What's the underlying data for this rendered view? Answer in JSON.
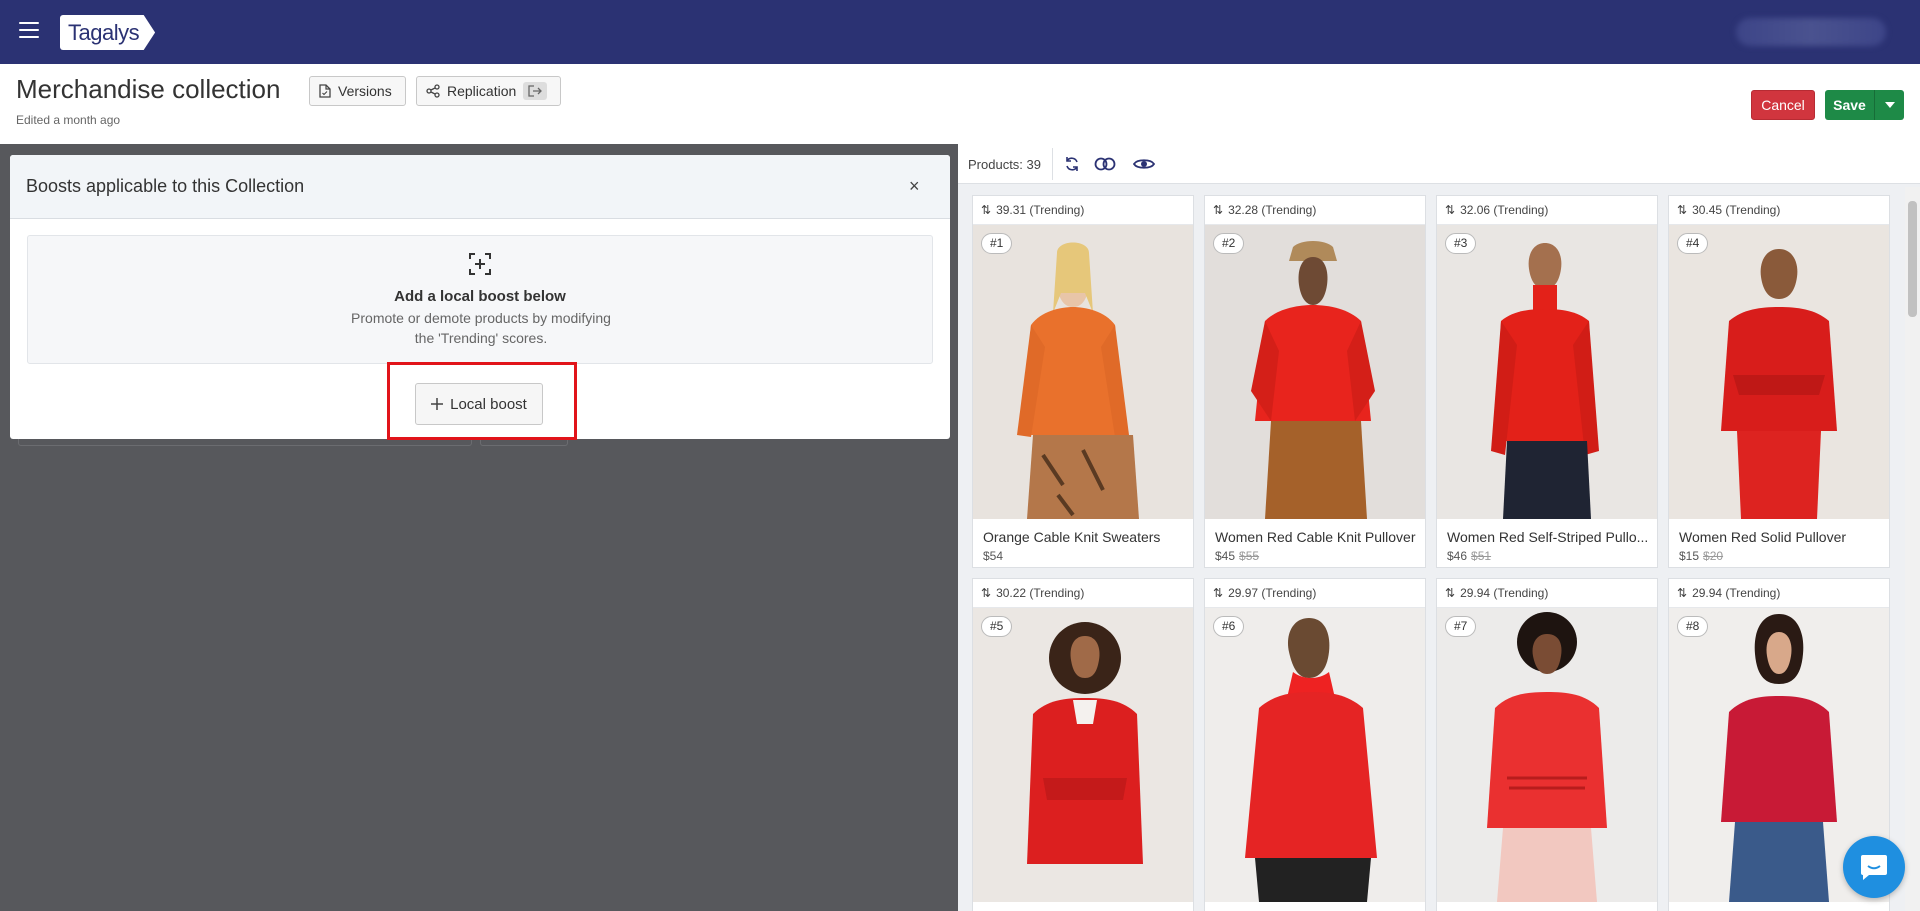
{
  "app": {
    "logo": "Tagalys"
  },
  "header": {
    "title": "Merchandise collection",
    "edited": "Edited a month ago",
    "versions_label": "Versions",
    "replication_label": "Replication",
    "cancel_label": "Cancel",
    "save_label": "Save"
  },
  "modal": {
    "title": "Boosts applicable to this Collection",
    "close": "×",
    "empty_title": "Add a local boost below",
    "empty_desc": "Promote or demote products by modifying the 'Trending' scores.",
    "local_boost_label": "Local boost"
  },
  "products": {
    "count_label": "Products: 39",
    "cards": [
      {
        "score": "39.31 (Trending)",
        "rank": "#1",
        "name": "Orange Cable Knit Sweaters",
        "price": "$54",
        "old_price": ""
      },
      {
        "score": "32.28 (Trending)",
        "rank": "#2",
        "name": "Women Red Cable Knit Pullover",
        "price": "$45",
        "old_price": "$55"
      },
      {
        "score": "32.06 (Trending)",
        "rank": "#3",
        "name": "Women Red Self-Striped Pullo...",
        "price": "$46",
        "old_price": "$51"
      },
      {
        "score": "30.45 (Trending)",
        "rank": "#4",
        "name": "Women Red Solid Pullover",
        "price": "$15",
        "old_price": "$20"
      },
      {
        "score": "30.22 (Trending)",
        "rank": "#5",
        "name": "",
        "price": "",
        "old_price": ""
      },
      {
        "score": "29.97 (Trending)",
        "rank": "#6",
        "name": "",
        "price": "",
        "old_price": ""
      },
      {
        "score": "29.94 (Trending)",
        "rank": "#7",
        "name": "",
        "price": "",
        "old_price": ""
      },
      {
        "score": "29.94 (Trending)",
        "rank": "#8",
        "name": "",
        "price": "",
        "old_price": ""
      }
    ]
  },
  "colors": {
    "topbar": "#2b3273",
    "cancel": "#d1353e",
    "save": "#1e8a47",
    "highlight": "#e1141a",
    "chat": "#1f8fe0"
  }
}
